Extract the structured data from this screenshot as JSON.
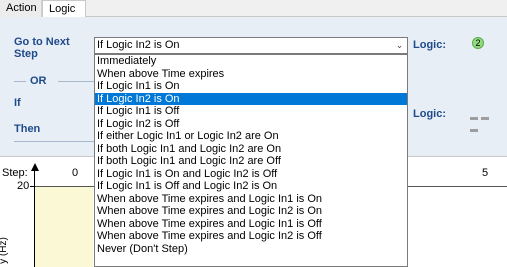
{
  "tabs": [
    {
      "label": "Action"
    },
    {
      "label": "Logic"
    }
  ],
  "logic": {
    "goto_label": "Go to Next Step",
    "or_label": "OR",
    "if_label": "If",
    "then_label": "Then",
    "logic_label": "Logic:",
    "logic_badge": "2",
    "combo_value": "If Logic In2 is On",
    "options": [
      "Immediately",
      "When above Time expires",
      "If Logic In1 is On",
      "If Logic In2 is On",
      "If Logic In1 is Off",
      "If Logic In2 is Off",
      "If either Logic In1 or Logic In2 are On",
      "If both Logic In1 and Logic In2 are On",
      "If both Logic In1 and Logic In2 are Off",
      "If Logic In1 is On and Logic In2 is Off",
      "If Logic In1 is Off and Logic In2 is On",
      "When above Time expires and Logic In1 is On",
      "When above Time expires and Logic In2 is On",
      "When above Time expires and Logic In1 is Off",
      "When above Time expires and Logic In2 is Off",
      "Never (Don't Step)"
    ],
    "selected_index": 3
  },
  "chart": {
    "step_label": "Step:",
    "y_tick": "20",
    "x_tick_first": "0",
    "x_tick_last": "5",
    "y_axis_label": "y (Hz)"
  },
  "colors": {
    "label_blue": "#1f4a8c",
    "panel_bg": "#e8eef5",
    "selection": "#0078d7",
    "badge_green": "#8fdc7f"
  }
}
